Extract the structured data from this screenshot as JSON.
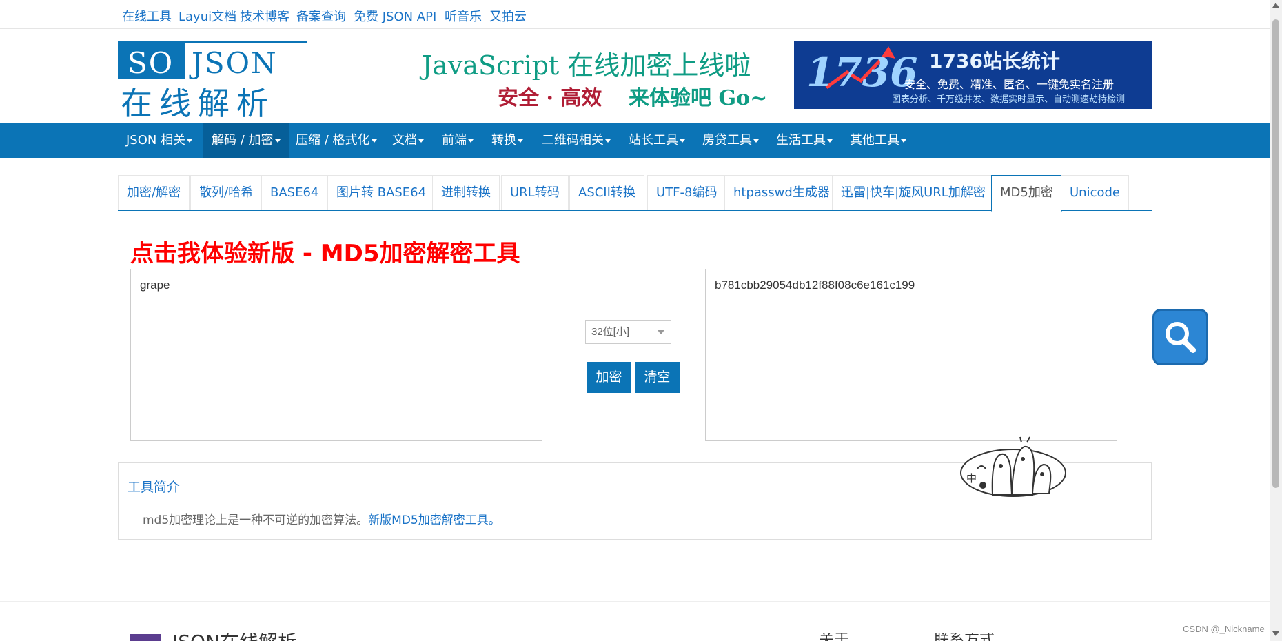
{
  "topbar": {
    "links": [
      "在线工具",
      "Layui文档",
      "技术博客",
      "备案查询",
      "免费 JSON API",
      "听音乐",
      "又拍云"
    ]
  },
  "logo": {
    "so": "SO",
    "json": "JSON",
    "cn": "在线解析"
  },
  "promo": {
    "line1": "JavaScript 在线加密上线啦",
    "line2a": "安全 · 高效",
    "line2b": "来体验吧 Go~"
  },
  "ad": {
    "number": "1736",
    "title": "1736站长统计",
    "sub1": "安全、免费、精准、匿名、一键免实名注册",
    "sub2": "图表分析、千万级并发、数据实时显示、自动测速劫持检测"
  },
  "nav": {
    "items": [
      "JSON 相关",
      "解码 / 加密",
      "压缩 / 格式化",
      "文档",
      "前端",
      "转换",
      "二维码相关",
      "站长工具",
      "房贷工具",
      "生活工具",
      "其他工具"
    ],
    "active_index": 1
  },
  "tabs": {
    "items": [
      "加密/解密",
      "散列/哈希",
      "BASE64",
      "图片转 BASE64",
      "进制转换",
      "URL转码",
      "ASCII转换",
      "UTF-8编码",
      "htpasswd生成器",
      "迅雷|快车|旋风URL加解密",
      "MD5加密",
      "Unicode"
    ],
    "active_index": 10
  },
  "headline": "点击我体验新版 - MD5加密解密工具",
  "input": {
    "value": "grape"
  },
  "output": {
    "value": "b781cbb29054db12f88f08c6e161c199"
  },
  "mode_select": {
    "value": "32位[小]"
  },
  "buttons": {
    "encrypt": "加密",
    "clear": "清空"
  },
  "intro": {
    "title": "工具简介",
    "text": "md5加密理论上是一种不可逆的加密算法。",
    "link": "新版MD5加密解密工具。"
  },
  "sticker": {
    "label": "中"
  },
  "footer": {
    "brand": "JSON在线解析",
    "col1": "关于",
    "col2": "联系方式"
  },
  "watermark": "CSDN @_Nickname",
  "colors": {
    "primary": "#0b74b6",
    "headline": "#ff0000",
    "link": "#1a73c7"
  }
}
